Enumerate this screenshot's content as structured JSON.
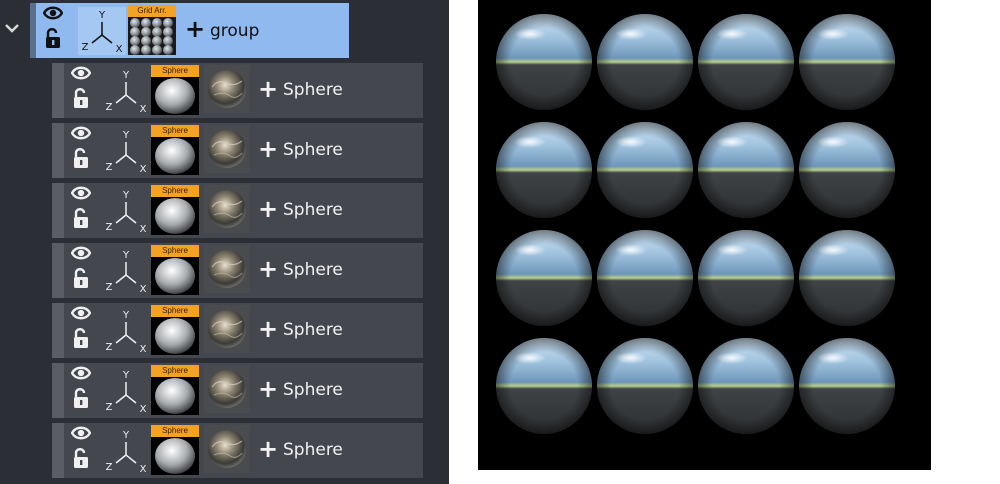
{
  "tree": {
    "group": {
      "plus": "+",
      "label": "group",
      "thumb_tag": "Grid Arr.",
      "axis_x": "X",
      "axis_y": "Y",
      "axis_z": "Z"
    },
    "items": [
      {
        "plus": "+",
        "label": "Sphere",
        "thumb_tag": "Sphere",
        "axis_x": "X",
        "axis_y": "Y",
        "axis_z": "Z"
      },
      {
        "plus": "+",
        "label": "Sphere",
        "thumb_tag": "Sphere",
        "axis_x": "X",
        "axis_y": "Y",
        "axis_z": "Z"
      },
      {
        "plus": "+",
        "label": "Sphere",
        "thumb_tag": "Sphere",
        "axis_x": "X",
        "axis_y": "Y",
        "axis_z": "Z"
      },
      {
        "plus": "+",
        "label": "Sphere",
        "thumb_tag": "Sphere",
        "axis_x": "X",
        "axis_y": "Y",
        "axis_z": "Z"
      },
      {
        "plus": "+",
        "label": "Sphere",
        "thumb_tag": "Sphere",
        "axis_x": "X",
        "axis_y": "Y",
        "axis_z": "Z"
      },
      {
        "plus": "+",
        "label": "Sphere",
        "thumb_tag": "Sphere",
        "axis_x": "X",
        "axis_y": "Y",
        "axis_z": "Z"
      },
      {
        "plus": "+",
        "label": "Sphere",
        "thumb_tag": "Sphere",
        "axis_x": "X",
        "axis_y": "Y",
        "axis_z": "Z"
      }
    ]
  },
  "viewport": {
    "grid_rows": 4,
    "grid_cols": 4,
    "background": "#000000"
  },
  "colors": {
    "panel_bg": "#2b2e34",
    "row_bg": "#44474e",
    "group_bg": "#8fb9ef",
    "tag_orange": "#f4a224"
  }
}
